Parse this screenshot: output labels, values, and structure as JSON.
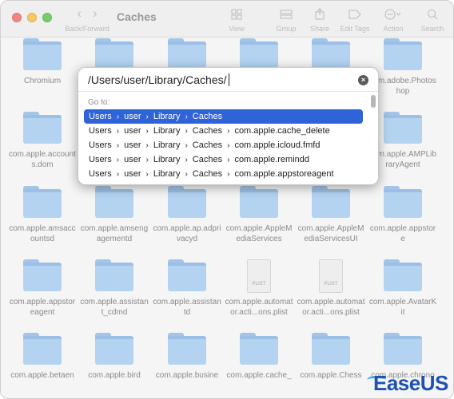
{
  "window": {
    "title": "Caches",
    "toolbar": {
      "nav_label": "Back/Forward",
      "view_label": "View",
      "group_label": "Group",
      "share_label": "Share",
      "edit_tags_label": "Edit Tags",
      "action_label": "Action",
      "search_label": "Search"
    }
  },
  "files": [
    {
      "name": "Chromium",
      "kind": "folder"
    },
    {
      "name": "",
      "kind": "folder"
    },
    {
      "name": "",
      "kind": "folder"
    },
    {
      "name": "",
      "kind": "folder"
    },
    {
      "name": "",
      "kind": "folder"
    },
    {
      "name": "com.adobe.Photoshop",
      "kind": "folder"
    },
    {
      "name": "com.apple.accounts.dom",
      "kind": "folder"
    },
    {
      "name": "",
      "kind": "folder"
    },
    {
      "name": "",
      "kind": "folder"
    },
    {
      "name": "",
      "kind": "folder"
    },
    {
      "name": "",
      "kind": "folder"
    },
    {
      "name": "com.apple.AMPLibraryAgent",
      "kind": "folder"
    },
    {
      "name": "com.apple.amsaccountsd",
      "kind": "folder"
    },
    {
      "name": "com.apple.amsengagementd",
      "kind": "folder"
    },
    {
      "name": "com.apple.ap.adprivacyd",
      "kind": "folder"
    },
    {
      "name": "com.apple.AppleMediaServices",
      "kind": "folder"
    },
    {
      "name": "com.apple.AppleMediaServicesUI",
      "kind": "folder"
    },
    {
      "name": "com.apple.appstore",
      "kind": "folder"
    },
    {
      "name": "com.apple.appstoreagent",
      "kind": "folder"
    },
    {
      "name": "com.apple.assistant_cdmd",
      "kind": "folder"
    },
    {
      "name": "com.apple.assistantd",
      "kind": "folder"
    },
    {
      "name": "com.apple.automator.acti...ons.plist",
      "kind": "plist"
    },
    {
      "name": "com.apple.automator.acti...ons.plist",
      "kind": "plist"
    },
    {
      "name": "com.apple.AvatarKit",
      "kind": "folder"
    },
    {
      "name": "com.apple.betaen",
      "kind": "folder"
    },
    {
      "name": "com.apple.bird",
      "kind": "folder"
    },
    {
      "name": "com.apple.busine",
      "kind": "folder"
    },
    {
      "name": "com.apple.cache_",
      "kind": "folder"
    },
    {
      "name": "com.apple.Chess",
      "kind": "folder"
    },
    {
      "name": "com.apple.chrono",
      "kind": "folder"
    }
  ],
  "plist_badge": "PLIST",
  "goto": {
    "path": "/Users/user/Library/Caches/",
    "label": "Go to:",
    "clear_glyph": "×",
    "separator": "›",
    "suggestions": [
      [
        "Users",
        "user",
        "Library",
        "Caches"
      ],
      [
        "Users",
        "user",
        "Library",
        "Caches",
        "com.apple.cache_delete"
      ],
      [
        "Users",
        "user",
        "Library",
        "Caches",
        "com.apple.icloud.fmfd"
      ],
      [
        "Users",
        "user",
        "Library",
        "Caches",
        "com.apple.remindd"
      ],
      [
        "Users",
        "user",
        "Library",
        "Caches",
        "com.apple.appstoreagent"
      ]
    ]
  },
  "watermark": {
    "text": "EaseUS"
  },
  "colors": {
    "selection": "#2f63d8",
    "folder": "#a9cdf0",
    "logo": "#1d52b5"
  }
}
